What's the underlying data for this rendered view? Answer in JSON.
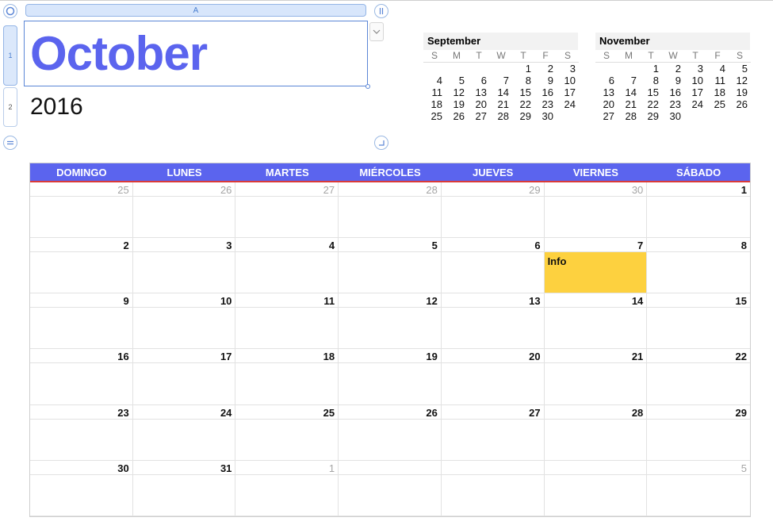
{
  "editor": {
    "column_label": "A",
    "rows": [
      "1",
      "2"
    ]
  },
  "title": {
    "month": "October",
    "year": "2016"
  },
  "mini_calendars": [
    {
      "month": "September",
      "weekdays": [
        "S",
        "M",
        "T",
        "W",
        "T",
        "F",
        "S"
      ],
      "days": [
        "",
        "",
        "",
        "",
        "1",
        "2",
        "3",
        "4",
        "5",
        "6",
        "7",
        "8",
        "9",
        "10",
        "11",
        "12",
        "13",
        "14",
        "15",
        "16",
        "17",
        "18",
        "19",
        "20",
        "21",
        "22",
        "23",
        "24",
        "25",
        "26",
        "27",
        "28",
        "29",
        "30",
        ""
      ]
    },
    {
      "month": "November",
      "weekdays": [
        "S",
        "M",
        "T",
        "W",
        "T",
        "F",
        "S"
      ],
      "days": [
        "",
        "",
        "1",
        "2",
        "3",
        "4",
        "5",
        "6",
        "7",
        "8",
        "9",
        "10",
        "11",
        "12",
        "13",
        "14",
        "15",
        "16",
        "17",
        "18",
        "19",
        "20",
        "21",
        "22",
        "23",
        "24",
        "25",
        "26",
        "27",
        "28",
        "29",
        "30",
        "",
        "",
        ""
      ]
    }
  ],
  "calendar": {
    "weekdays": [
      "DOMINGO",
      "LUNES",
      "MARTES",
      "MIÉRCOLES",
      "JUEVES",
      "VIERNES",
      "SÁBADO"
    ],
    "cells": [
      {
        "day": "25",
        "muted": true
      },
      {
        "day": "26",
        "muted": true
      },
      {
        "day": "27",
        "muted": true
      },
      {
        "day": "28",
        "muted": true
      },
      {
        "day": "29",
        "muted": true
      },
      {
        "day": "30",
        "muted": true
      },
      {
        "day": "1"
      },
      {
        "day": "2"
      },
      {
        "day": "3"
      },
      {
        "day": "4"
      },
      {
        "day": "5"
      },
      {
        "day": "6"
      },
      {
        "day": "7",
        "event": "Info"
      },
      {
        "day": "8"
      },
      {
        "day": "9"
      },
      {
        "day": "10"
      },
      {
        "day": "11"
      },
      {
        "day": "12"
      },
      {
        "day": "13"
      },
      {
        "day": "14"
      },
      {
        "day": "15"
      },
      {
        "day": "16"
      },
      {
        "day": "17"
      },
      {
        "day": "18"
      },
      {
        "day": "19"
      },
      {
        "day": "20"
      },
      {
        "day": "21"
      },
      {
        "day": "22"
      },
      {
        "day": "23"
      },
      {
        "day": "24"
      },
      {
        "day": "25"
      },
      {
        "day": "26"
      },
      {
        "day": "27"
      },
      {
        "day": "28"
      },
      {
        "day": "29"
      },
      {
        "day": "30"
      },
      {
        "day": "31"
      },
      {
        "day": "1",
        "muted": true
      },
      {
        "day": ""
      },
      {
        "day": ""
      },
      {
        "day": ""
      },
      {
        "day": "5",
        "muted": true
      }
    ]
  },
  "colors": {
    "title": "#5b64ee",
    "header_bg": "#5b64ee",
    "header_rule": "#d93a3a",
    "event": "#fdd13f",
    "selection": "#5b86d6"
  }
}
